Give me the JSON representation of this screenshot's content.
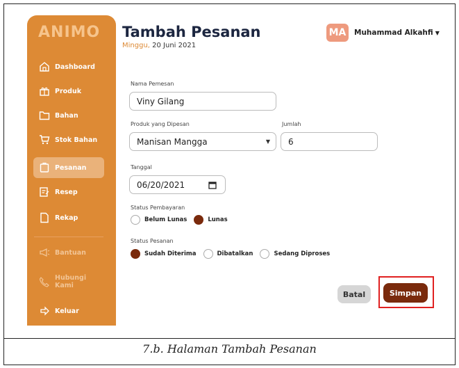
{
  "app": {
    "logo": "ANIM",
    "logo_o": "O"
  },
  "sidebar": {
    "items": [
      {
        "label": "Dashboard",
        "icon": "home-icon"
      },
      {
        "label": "Produk",
        "icon": "gift-icon"
      },
      {
        "label": "Bahan",
        "icon": "folder-icon"
      },
      {
        "label": "Stok Bahan",
        "icon": "cart-icon"
      },
      {
        "label": "Pesanan",
        "icon": "order-icon"
      },
      {
        "label": "Resep",
        "icon": "recipe-icon"
      },
      {
        "label": "Rekap",
        "icon": "document-icon"
      },
      {
        "label": "Bantuan",
        "icon": "megaphone-icon"
      },
      {
        "label": "Hubungi Kami",
        "icon": "phone-icon"
      },
      {
        "label": "Keluar",
        "icon": "logout-icon"
      }
    ]
  },
  "header": {
    "title": "Tambah Pesanan",
    "day": "Minggu,",
    "date": "20 Juni 2021",
    "avatar_initials": "MA",
    "username": "Muhammad Alkahfi"
  },
  "form": {
    "name_label": "Nama Pemesan",
    "name_value": "Viny Gilang",
    "product_label": "Produk yang Dipesan",
    "product_value": "Manisan Mangga",
    "qty_label": "Jumlah",
    "qty_value": "6",
    "date_label": "Tanggal",
    "date_value": "06/20/2021",
    "payment_label": "Status Pembayaran",
    "payment_options": [
      "Belum Lunas",
      "Lunas"
    ],
    "payment_selected": "Lunas",
    "order_label": "Status Pesanan",
    "order_options": [
      "Sudah Diterima",
      "Dibatalkan",
      "Sedang Diproses"
    ],
    "order_selected": "Sudah Diterima",
    "cancel_label": "Batal",
    "save_label": "Simpan"
  },
  "caption": "7.b.  Halaman Tambah Pesanan",
  "colors": {
    "sidebar": "#dd8a35",
    "accent": "#7a2a0c",
    "highlight": "#e02020"
  }
}
